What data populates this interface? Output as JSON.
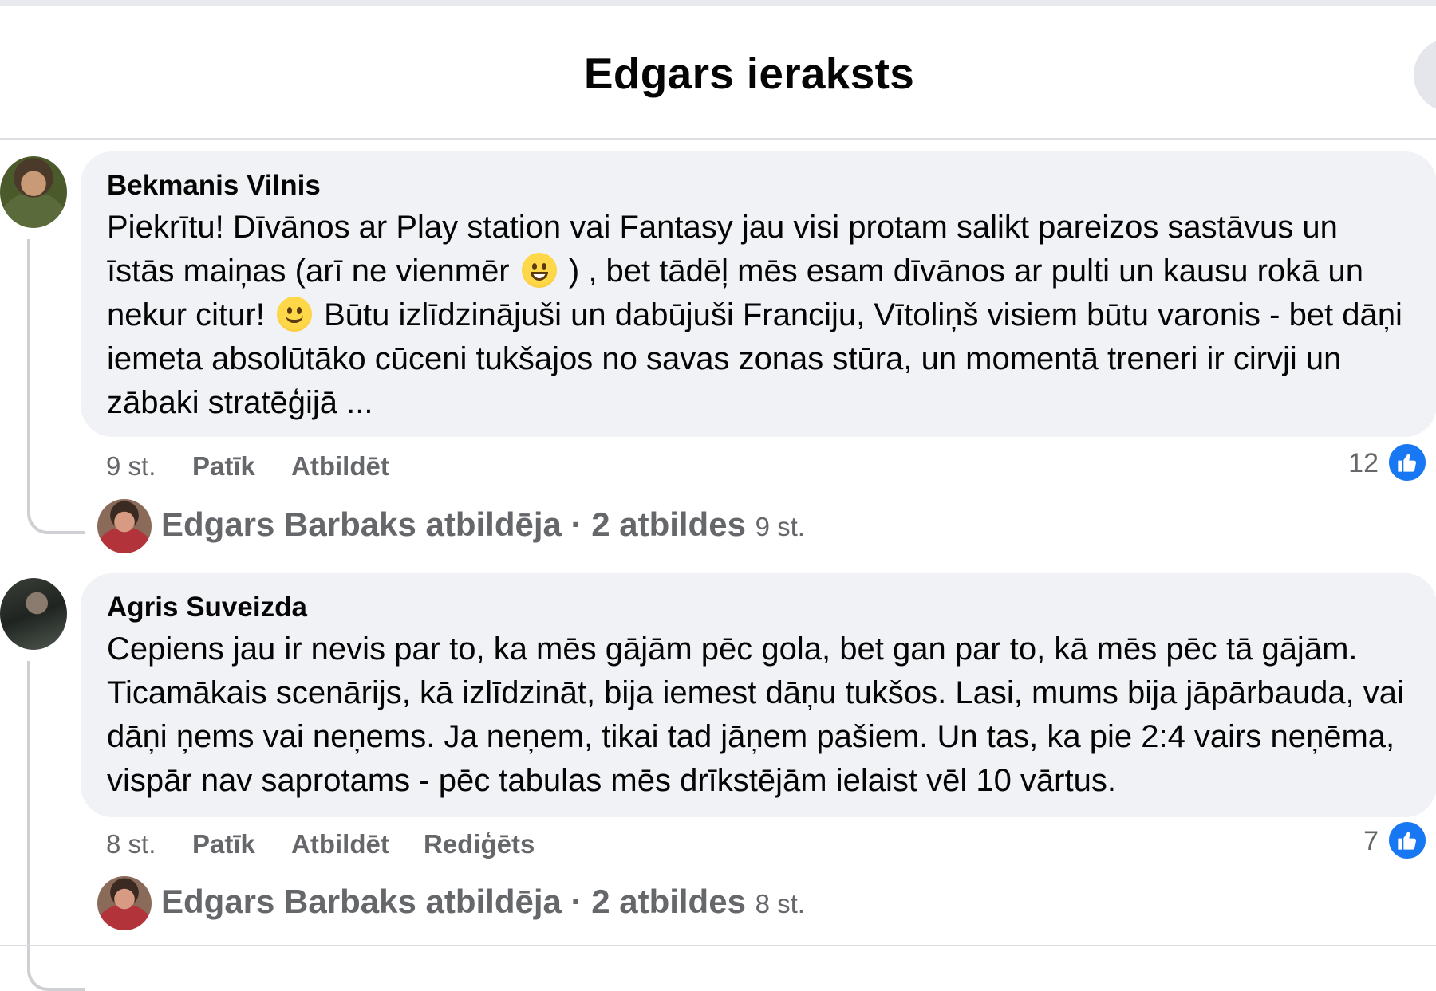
{
  "post": {
    "title": "Edgars ieraksts"
  },
  "comments": [
    {
      "author": "Bekmanis Vilnis",
      "text_parts": [
        "Piekrītu! Dīvānos ar Play station vai Fantasy jau visi protam salikt pareizos sastāvus un īstās maiņas (arī ne vienmēr",
        ") , bet tādēļ mēs esam dīvānos ar pulti un kausu rokā un nekur citur!",
        "Būtu izlīdzinājuši un dabūjuši Franciju, Vītoliņš visiem būtu varonis - bet dāņi iemeta absolūtāko cūceni tukšajos no savas zonas stūra, un momentā treneri ir cirvji un zābaki stratēģijā ..."
      ],
      "emojis": [
        "grinning-face-icon",
        "slightly-smiling-face-icon"
      ],
      "time": "9 st.",
      "like_label": "Patīk",
      "reply_label": "Atbildēt",
      "like_count": "12",
      "reply_summary": {
        "text": "Edgars Barbaks atbildēja · 2 atbildes",
        "time": "9 st."
      }
    },
    {
      "author": "Agris Suveizda",
      "text": "Cepiens jau ir nevis par to, ka mēs gājām pēc gola, bet gan par to, kā mēs pēc tā gājām. Ticamākais scenārijs, kā izlīdzināt, bija iemest dāņu tukšos. Lasi, mums bija jāpārbauda, vai dāņi ņems vai neņems. Ja neņem, tikai tad jāņem pašiem. Un tas, ka pie 2:4 vairs neņēma, vispār nav saprotams - pēc tabulas mēs drīkstējām ielaist vēl 10 vārtus.",
      "time": "8 st.",
      "like_label": "Patīk",
      "reply_label": "Atbildēt",
      "edited_label": "Rediģēts",
      "like_count": "7",
      "reply_summary": {
        "text": "Edgars Barbaks atbildēja · 2 atbildes",
        "time": "8 st."
      }
    }
  ],
  "colors": {
    "bubble": "#f0f2f5",
    "secondary_text": "#65676b",
    "like_blue": "#1877f2"
  }
}
